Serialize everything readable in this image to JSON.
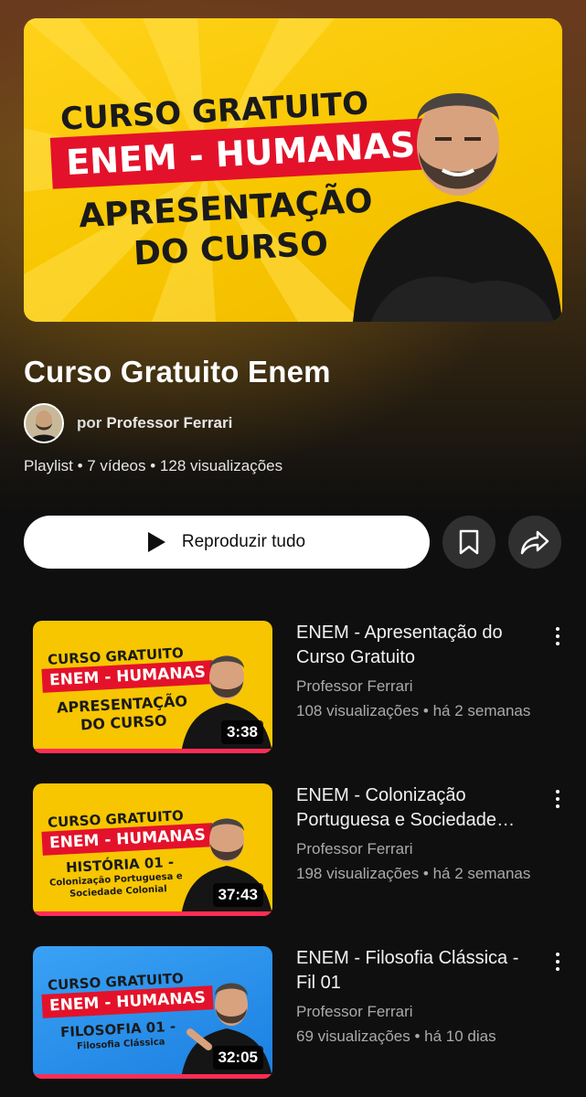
{
  "header": {
    "back_icon": "arrow-left-icon",
    "cast_icon": "cast-icon",
    "search_icon": "search-icon",
    "more_icon": "more-vert-icon"
  },
  "hero": {
    "line1": "CURSO GRATUITO",
    "line2": "ENEM - HUMANAS",
    "line3": "APRESENTAÇÃO",
    "line4": "DO CURSO"
  },
  "playlist": {
    "title": "Curso Gratuito Enem",
    "by": "por",
    "owner": "Professor Ferrari",
    "meta": "Playlist • 7 vídeos • 128 visualizações"
  },
  "actions": {
    "play_all": "Reproduzir tudo",
    "save_icon": "bookmark-icon",
    "share_icon": "share-icon"
  },
  "videos": [
    {
      "title": "ENEM - Apresentação do Curso Gratuito",
      "channel": "Professor Ferrari",
      "stats": "108 visualizações • há 2 semanas",
      "duration": "3:38",
      "thumb": {
        "l1": "CURSO GRATUITO",
        "l2": "ENEM - HUMANAS",
        "l3": "APRESENTAÇÃO",
        "l4": "DO CURSO",
        "bg": "#f7c600"
      }
    },
    {
      "title": "ENEM - Colonização Portuguesa e Sociedade Colonial",
      "channel": "Professor Ferrari",
      "stats": "198 visualizações • há 2 semanas",
      "duration": "37:43",
      "thumb": {
        "l1": "CURSO GRATUITO",
        "l2": "ENEM - HUMANAS",
        "l3": "HISTÓRIA 01 -",
        "l4": "Colonização Portuguesa e",
        "l5": "Sociedade Colonial",
        "bg": "#f7c600"
      }
    },
    {
      "title": "ENEM - Filosofia Clássica - Fil 01",
      "channel": "Professor Ferrari",
      "stats": "69 visualizações • há 10 dias",
      "duration": "32:05",
      "thumb": {
        "l1": "CURSO GRATUITO",
        "l2": "ENEM - HUMANAS",
        "l3": "FILOSOFIA 01 -",
        "l4": "Filosofia Clássica",
        "bg": "#1e8fe8"
      }
    }
  ]
}
